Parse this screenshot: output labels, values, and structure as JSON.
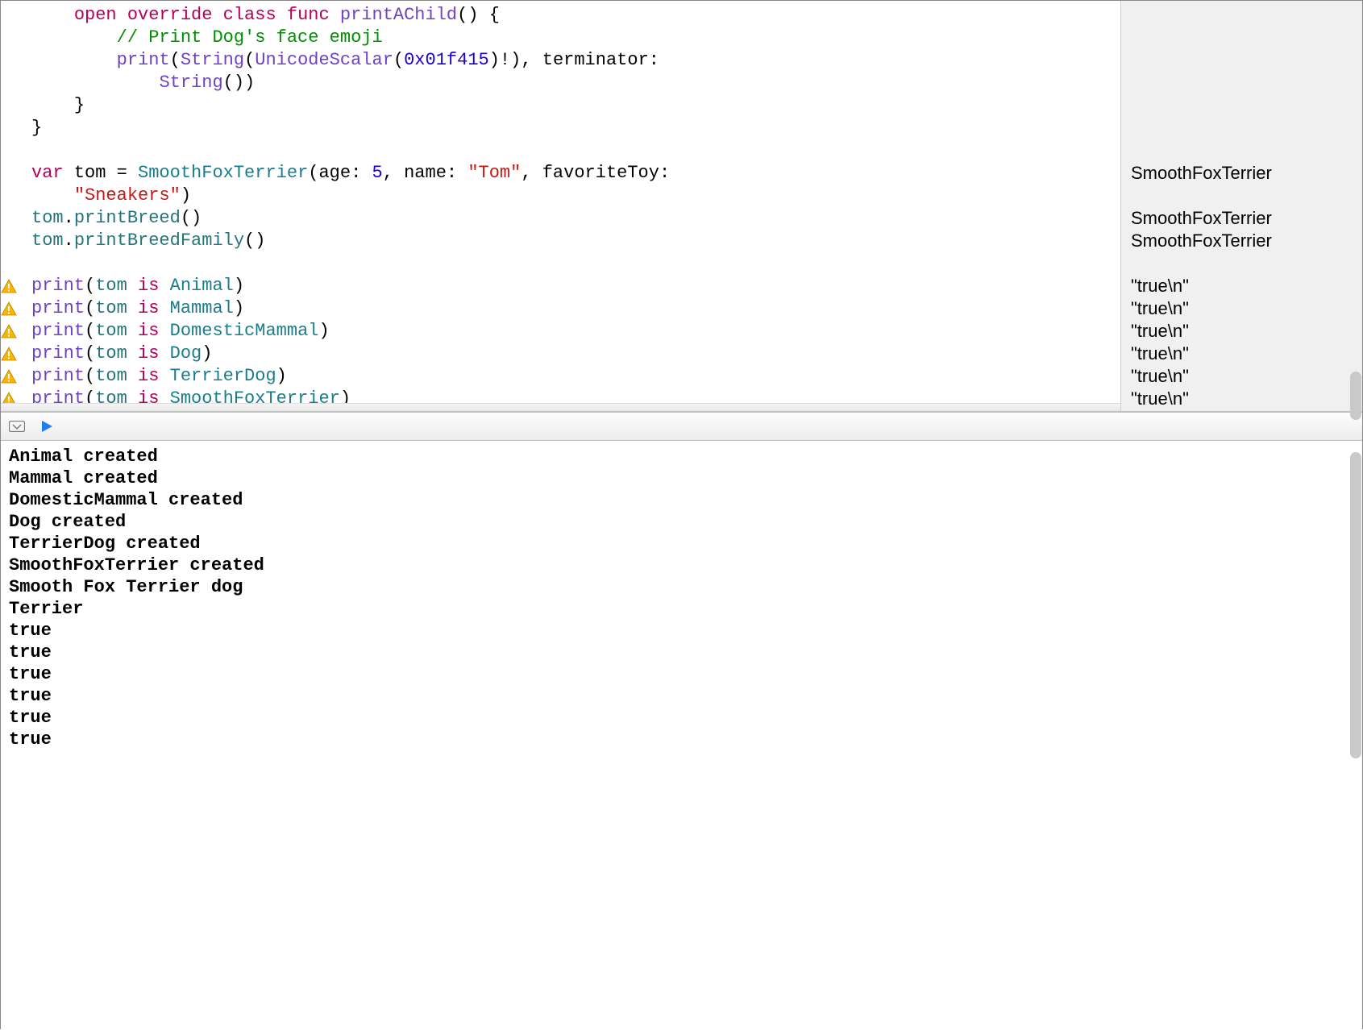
{
  "code": {
    "lines": [
      {
        "gutter": "",
        "tokens": [
          {
            "cls": "black",
            "t": "    "
          },
          {
            "cls": "kw-pink",
            "t": "open"
          },
          {
            "cls": "black",
            "t": " "
          },
          {
            "cls": "kw-pink",
            "t": "override"
          },
          {
            "cls": "black",
            "t": " "
          },
          {
            "cls": "kw-pink",
            "t": "class"
          },
          {
            "cls": "black",
            "t": " "
          },
          {
            "cls": "kw-pink",
            "t": "func"
          },
          {
            "cls": "black",
            "t": " "
          },
          {
            "cls": "fn-mag",
            "t": "printAChild"
          },
          {
            "cls": "black",
            "t": "() {"
          }
        ]
      },
      {
        "gutter": "",
        "tokens": [
          {
            "cls": "black",
            "t": "        "
          },
          {
            "cls": "comment",
            "t": "// Print Dog's face emoji"
          }
        ]
      },
      {
        "gutter": "",
        "tokens": [
          {
            "cls": "black",
            "t": "        "
          },
          {
            "cls": "fn-mag",
            "t": "print"
          },
          {
            "cls": "black",
            "t": "("
          },
          {
            "cls": "fn-mag",
            "t": "String"
          },
          {
            "cls": "black",
            "t": "("
          },
          {
            "cls": "fn-mag",
            "t": "UnicodeScalar"
          },
          {
            "cls": "black",
            "t": "("
          },
          {
            "cls": "kw-blue",
            "t": "0x01f415"
          },
          {
            "cls": "black",
            "t": ")!), terminator:"
          }
        ]
      },
      {
        "gutter": "",
        "tokens": [
          {
            "cls": "black",
            "t": "            "
          },
          {
            "cls": "fn-mag",
            "t": "String"
          },
          {
            "cls": "black",
            "t": "())"
          }
        ]
      },
      {
        "gutter": "",
        "tokens": [
          {
            "cls": "black",
            "t": "    }"
          }
        ]
      },
      {
        "gutter": "",
        "tokens": [
          {
            "cls": "black",
            "t": "}"
          }
        ]
      },
      {
        "gutter": "",
        "tokens": [
          {
            "cls": "black",
            "t": " "
          }
        ]
      },
      {
        "gutter": "",
        "tokens": [
          {
            "cls": "kw-pink",
            "t": "var"
          },
          {
            "cls": "black",
            "t": " tom = "
          },
          {
            "cls": "type-teal",
            "t": "SmoothFoxTerrier"
          },
          {
            "cls": "black",
            "t": "(age: "
          },
          {
            "cls": "kw-blue",
            "t": "5"
          },
          {
            "cls": "black",
            "t": ", name: "
          },
          {
            "cls": "str-red",
            "t": "\"Tom\""
          },
          {
            "cls": "black",
            "t": ", favoriteToy:"
          }
        ]
      },
      {
        "gutter": "",
        "tokens": [
          {
            "cls": "black",
            "t": "    "
          },
          {
            "cls": "str-red",
            "t": "\"Sneakers\""
          },
          {
            "cls": "black",
            "t": ")"
          }
        ]
      },
      {
        "gutter": "",
        "tokens": [
          {
            "cls": "fn-teal",
            "t": "tom"
          },
          {
            "cls": "black",
            "t": "."
          },
          {
            "cls": "fn-teal",
            "t": "printBreed"
          },
          {
            "cls": "black",
            "t": "()"
          }
        ]
      },
      {
        "gutter": "",
        "tokens": [
          {
            "cls": "fn-teal",
            "t": "tom"
          },
          {
            "cls": "black",
            "t": "."
          },
          {
            "cls": "fn-teal",
            "t": "printBreedFamily"
          },
          {
            "cls": "black",
            "t": "()"
          }
        ]
      },
      {
        "gutter": "",
        "tokens": [
          {
            "cls": "black",
            "t": " "
          }
        ]
      },
      {
        "gutter": "warn",
        "tokens": [
          {
            "cls": "fn-mag",
            "t": "print"
          },
          {
            "cls": "black",
            "t": "("
          },
          {
            "cls": "fn-teal",
            "t": "tom"
          },
          {
            "cls": "black",
            "t": " "
          },
          {
            "cls": "kw-pink",
            "t": "is"
          },
          {
            "cls": "black",
            "t": " "
          },
          {
            "cls": "type-teal",
            "t": "Animal"
          },
          {
            "cls": "black",
            "t": ")"
          }
        ]
      },
      {
        "gutter": "warn",
        "tokens": [
          {
            "cls": "fn-mag",
            "t": "print"
          },
          {
            "cls": "black",
            "t": "("
          },
          {
            "cls": "fn-teal",
            "t": "tom"
          },
          {
            "cls": "black",
            "t": " "
          },
          {
            "cls": "kw-pink",
            "t": "is"
          },
          {
            "cls": "black",
            "t": " "
          },
          {
            "cls": "type-teal",
            "t": "Mammal"
          },
          {
            "cls": "black",
            "t": ")"
          }
        ]
      },
      {
        "gutter": "warn",
        "tokens": [
          {
            "cls": "fn-mag",
            "t": "print"
          },
          {
            "cls": "black",
            "t": "("
          },
          {
            "cls": "fn-teal",
            "t": "tom"
          },
          {
            "cls": "black",
            "t": " "
          },
          {
            "cls": "kw-pink",
            "t": "is"
          },
          {
            "cls": "black",
            "t": " "
          },
          {
            "cls": "type-teal",
            "t": "DomesticMammal"
          },
          {
            "cls": "black",
            "t": ")"
          }
        ]
      },
      {
        "gutter": "warn",
        "tokens": [
          {
            "cls": "fn-mag",
            "t": "print"
          },
          {
            "cls": "black",
            "t": "("
          },
          {
            "cls": "fn-teal",
            "t": "tom"
          },
          {
            "cls": "black",
            "t": " "
          },
          {
            "cls": "kw-pink",
            "t": "is"
          },
          {
            "cls": "black",
            "t": " "
          },
          {
            "cls": "type-teal",
            "t": "Dog"
          },
          {
            "cls": "black",
            "t": ")"
          }
        ]
      },
      {
        "gutter": "warn",
        "tokens": [
          {
            "cls": "fn-mag",
            "t": "print"
          },
          {
            "cls": "black",
            "t": "("
          },
          {
            "cls": "fn-teal",
            "t": "tom"
          },
          {
            "cls": "black",
            "t": " "
          },
          {
            "cls": "kw-pink",
            "t": "is"
          },
          {
            "cls": "black",
            "t": " "
          },
          {
            "cls": "type-teal",
            "t": "TerrierDog"
          },
          {
            "cls": "black",
            "t": ")"
          }
        ]
      },
      {
        "gutter": "warn",
        "tokens": [
          {
            "cls": "fn-mag",
            "t": "print"
          },
          {
            "cls": "black",
            "t": "("
          },
          {
            "cls": "fn-teal",
            "t": "tom"
          },
          {
            "cls": "black",
            "t": " "
          },
          {
            "cls": "kw-pink",
            "t": "is"
          },
          {
            "cls": "black",
            "t": " "
          },
          {
            "cls": "type-teal",
            "t": "SmoothFoxTerrier"
          },
          {
            "cls": "black",
            "t": ")"
          }
        ]
      }
    ]
  },
  "results": [
    "",
    "",
    "",
    "",
    "",
    "",
    "",
    "SmoothFoxTerrier",
    "",
    "SmoothFoxTerrier",
    "SmoothFoxTerrier",
    "",
    "\"true\\n\"",
    "\"true\\n\"",
    "\"true\\n\"",
    "\"true\\n\"",
    "\"true\\n\"",
    "\"true\\n\""
  ],
  "console": [
    "Animal created",
    "Mammal created",
    "DomesticMammal created",
    "Dog created",
    "TerrierDog created",
    "SmoothFoxTerrier created",
    "Smooth Fox Terrier dog",
    "Terrier",
    "true",
    "true",
    "true",
    "true",
    "true",
    "true"
  ]
}
